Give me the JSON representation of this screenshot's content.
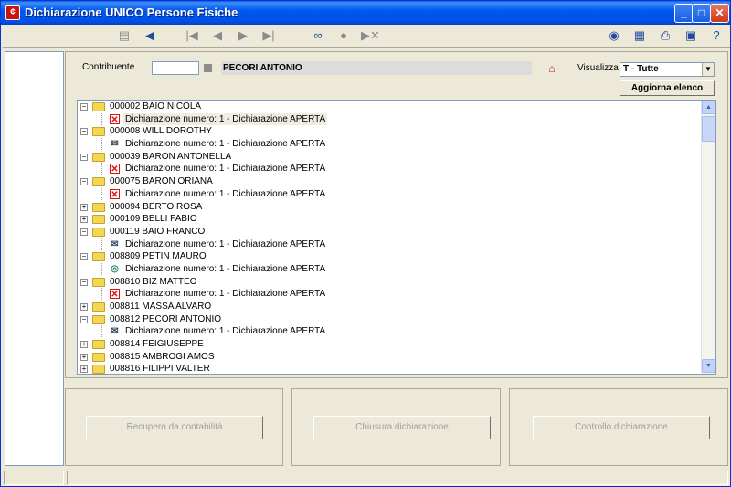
{
  "window": {
    "title": "Dichiarazione UNICO Persone Fisiche",
    "app_icon": "app-logo-icon",
    "controls": {
      "minimize": "_",
      "maximize": "□",
      "close": "✕",
      "minimize_icon": "minimize-icon",
      "maximize_icon": "maximize-icon",
      "close_icon": "close-icon"
    }
  },
  "toolbar": {
    "left_tools": [
      {
        "name": "save-icon",
        "glyph": "▤"
      },
      {
        "name": "back-arrow-icon",
        "glyph": "◀"
      },
      {
        "name": "first-record-icon",
        "glyph": "|◀"
      },
      {
        "name": "previous-record-icon",
        "glyph": "◀"
      },
      {
        "name": "next-record-icon",
        "glyph": "▶"
      },
      {
        "name": "last-record-icon",
        "glyph": "▶|"
      },
      {
        "name": "binoculars-icon",
        "glyph": "∞"
      },
      {
        "name": "circle-icon",
        "glyph": "●"
      },
      {
        "name": "delete-forward-icon",
        "glyph": "▶✕"
      }
    ],
    "right_tools": [
      {
        "name": "chat-icon",
        "glyph": "◉"
      },
      {
        "name": "calculator-icon",
        "glyph": "▦"
      },
      {
        "name": "printer-icon",
        "glyph": "⎙"
      },
      {
        "name": "window-icon",
        "glyph": "▣"
      },
      {
        "name": "help-icon",
        "glyph": "?"
      }
    ]
  },
  "filter": {
    "contribuente_label": "Contribuente",
    "contribuente_code": "",
    "contribuente_name": "PECORI ANTONIO",
    "house_icon": "house-icon",
    "visualizza_label": "Visualizza",
    "visualizza_value": "T   - Tutte",
    "refresh_button": "Aggiorna elenco"
  },
  "tree": [
    {
      "code": "000002 BAIO NICOLA",
      "expanded": true,
      "declaration": {
        "text": "Dichiarazione numero: 1 - Dichiarazione APERTA",
        "icon": "x",
        "selected": true
      }
    },
    {
      "code": "000008 WILL DOROTHY",
      "expanded": true,
      "declaration": {
        "text": "Dichiarazione numero: 1 - Dichiarazione APERTA",
        "icon": "env"
      }
    },
    {
      "code": "000039 BARON ANTONELLA",
      "expanded": true,
      "declaration": {
        "text": "Dichiarazione numero: 1 - Dichiarazione APERTA",
        "icon": "x"
      }
    },
    {
      "code": "000075 BARON ORIANA",
      "expanded": true,
      "declaration": {
        "text": "Dichiarazione numero: 1 - Dichiarazione APERTA",
        "icon": "x"
      }
    },
    {
      "code": "000094 BERTO ROSA",
      "expanded": false
    },
    {
      "code": "000109 BELLI FABIO",
      "expanded": false
    },
    {
      "code": "000119 BAIO FRANCO",
      "expanded": true,
      "declaration": {
        "text": "Dichiarazione numero: 1 - Dichiarazione APERTA",
        "icon": "env"
      }
    },
    {
      "code": "008809 PETIN MAURO",
      "expanded": true,
      "declaration": {
        "text": "Dichiarazione numero: 1 - Dichiarazione APERTA",
        "icon": "gear"
      }
    },
    {
      "code": "008810 BIZ MATTEO",
      "expanded": true,
      "declaration": {
        "text": "Dichiarazione numero: 1 - Dichiarazione APERTA",
        "icon": "x"
      }
    },
    {
      "code": "008811 MASSA ALVARO",
      "expanded": false
    },
    {
      "code": "008812 PECORI ANTONIO",
      "expanded": true,
      "declaration": {
        "text": "Dichiarazione numero: 1 - Dichiarazione APERTA",
        "icon": "env"
      }
    },
    {
      "code": "008814 FEIGIUSEPPE",
      "expanded": false
    },
    {
      "code": "008815 AMBROGI AMOS",
      "expanded": false
    },
    {
      "code": "008816 FILIPPI VALTER",
      "expanded": false
    }
  ],
  "scrollbar": {
    "up_icon": "scroll-up-icon",
    "down_icon": "scroll-down-icon"
  },
  "actions": [
    {
      "label": "Recupero da contabilità",
      "name": "recupero-button"
    },
    {
      "label": "Chiusura dichiarazione",
      "name": "chiusura-button"
    },
    {
      "label": "Controllo dichiarazione",
      "name": "controllo-button"
    }
  ],
  "colors": {
    "titlebar": "#0058ee",
    "window_bg": "#ece9d8",
    "tree_bg": "#ffffff",
    "folder": "#f5d652",
    "error_mark": "#dd1111"
  }
}
